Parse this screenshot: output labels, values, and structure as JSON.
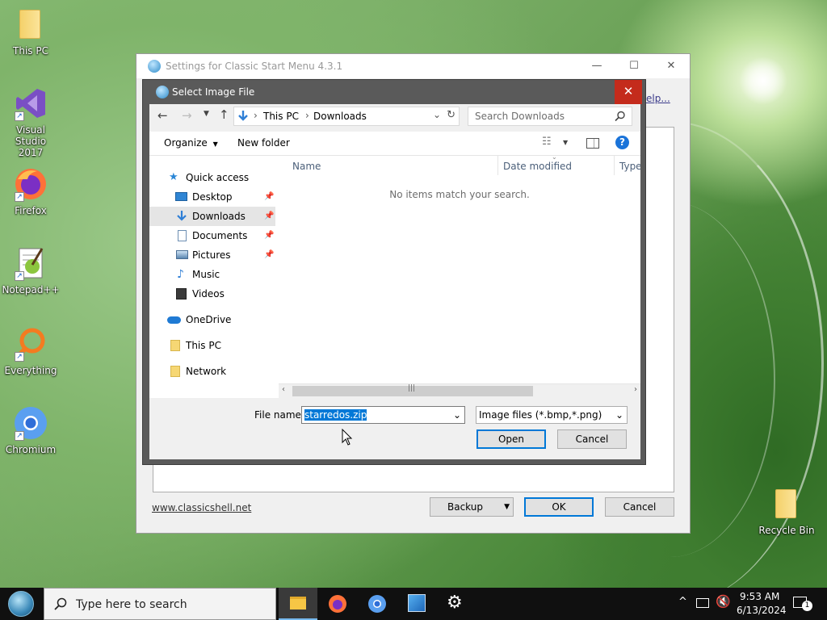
{
  "desktop": {
    "icons": [
      {
        "label": "This PC"
      },
      {
        "label": "Visual Studio 2017"
      },
      {
        "label": "Firefox"
      },
      {
        "label": "Notepad++"
      },
      {
        "label": "Everything"
      },
      {
        "label": "Chromium"
      },
      {
        "label": "Recycle Bin"
      }
    ]
  },
  "background_window": {
    "title": "Settings for Classic Start Menu 4.3.1",
    "help_link": "Help...",
    "website_link": "www.classicshell.net",
    "backup_button": "Backup",
    "ok_button": "OK",
    "cancel_button": "Cancel"
  },
  "dialog": {
    "title": "Select Image File",
    "close_symbol": "✕",
    "address": {
      "segments": [
        "This PC",
        "Downloads"
      ],
      "separator": "›"
    },
    "search_placeholder": "Search Downloads",
    "organize_label": "Organize",
    "new_folder_label": "New folder",
    "help_symbol": "?",
    "nav": [
      {
        "label": "Quick access",
        "pinned": false,
        "selected": false
      },
      {
        "label": "Desktop",
        "pinned": true,
        "selected": false
      },
      {
        "label": "Downloads",
        "pinned": true,
        "selected": true
      },
      {
        "label": "Documents",
        "pinned": true,
        "selected": false
      },
      {
        "label": "Pictures",
        "pinned": true,
        "selected": false
      },
      {
        "label": "Music",
        "pinned": false,
        "selected": false
      },
      {
        "label": "Videos",
        "pinned": false,
        "selected": false
      },
      {
        "label": "OneDrive",
        "pinned": false,
        "selected": false
      },
      {
        "label": "This PC",
        "pinned": false,
        "selected": false
      },
      {
        "label": "Network",
        "pinned": false,
        "selected": false
      }
    ],
    "columns": {
      "name": "Name",
      "date_modified": "Date modified",
      "type": "Type"
    },
    "empty_message": "No items match your search.",
    "file_name_label": "File name:",
    "file_name_value": "starredos.zip",
    "file_type_value": "Image files (*.bmp,*.png)",
    "open_button": "Open",
    "cancel_button": "Cancel"
  },
  "taskbar": {
    "search_placeholder": "Type here to search",
    "time": "9:53 AM",
    "date": "6/13/2024",
    "notification_count": "1"
  },
  "colors": {
    "accent": "#0078d7",
    "close_red": "#c42b1c"
  }
}
